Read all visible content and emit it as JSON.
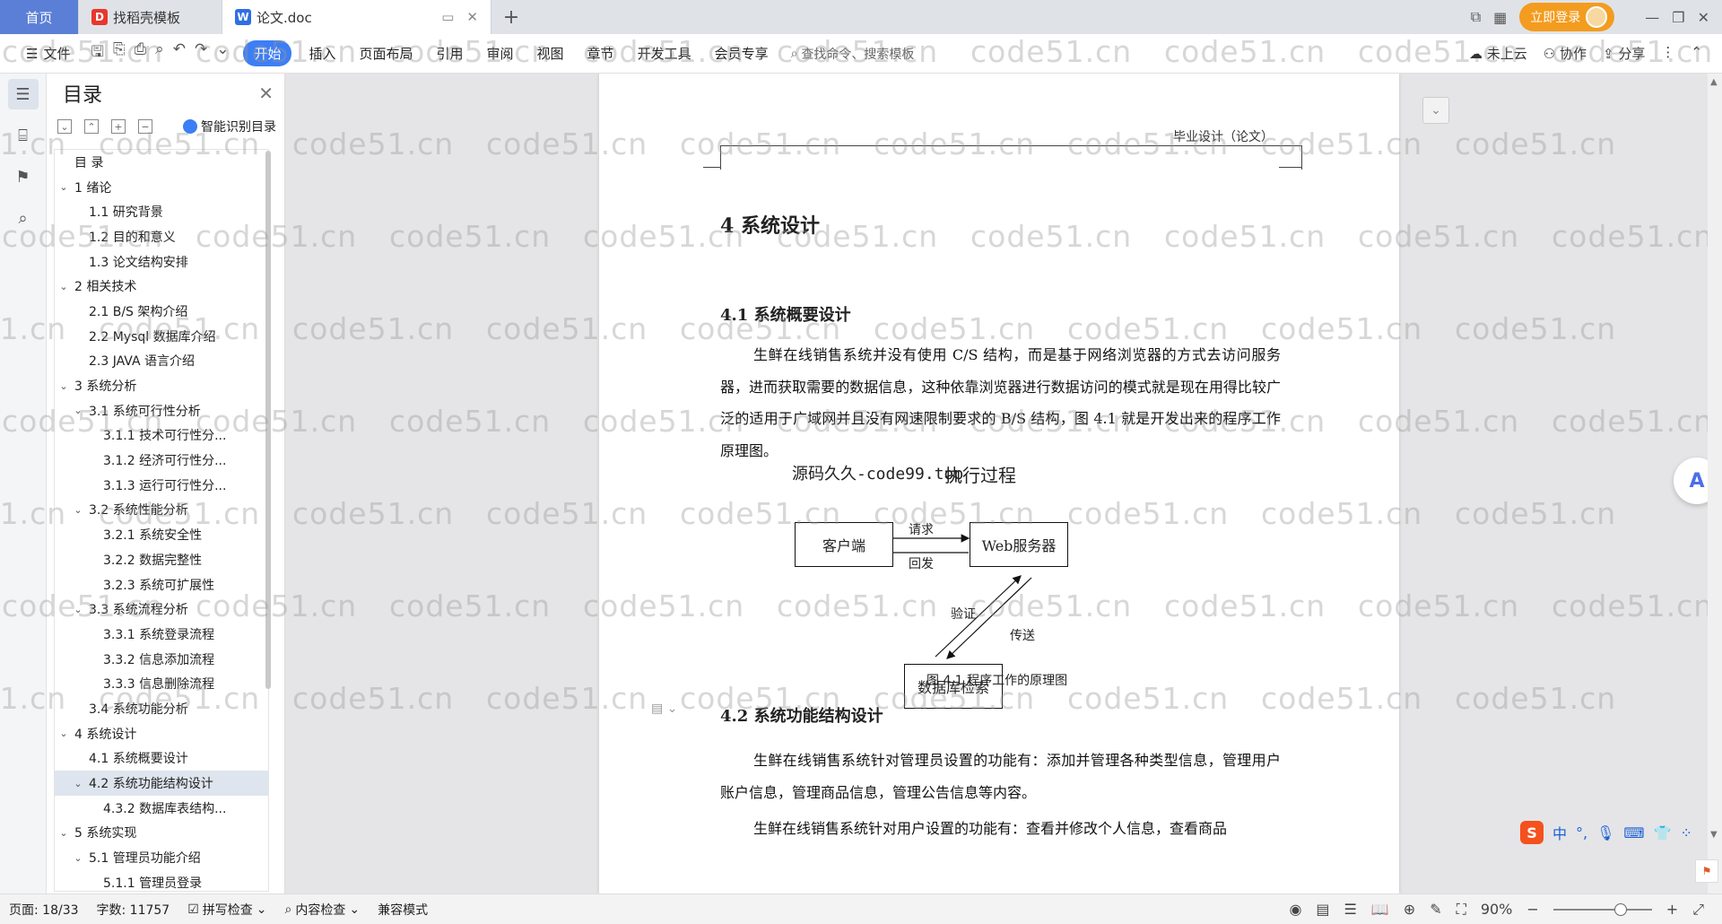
{
  "titlebar": {
    "tabs": [
      {
        "label": "首页"
      },
      {
        "label": "找稻壳模板"
      },
      {
        "label": "论文.doc"
      }
    ],
    "login_label": "立即登录"
  },
  "menubar": {
    "file": "文件",
    "start": "开始",
    "items": [
      "插入",
      "页面布局",
      "引用",
      "审阅",
      "视图",
      "章节",
      "开发工具",
      "会员专享"
    ],
    "search_placeholder": "查找命令、搜索模板",
    "cloud": "未上云",
    "collab": "协作",
    "share": "分享"
  },
  "toc": {
    "title": "目录",
    "ai_label": "智能识别目录",
    "items": [
      {
        "text": "目  录",
        "level": 1,
        "arrow": ""
      },
      {
        "text": "1  绪论",
        "level": 1,
        "arrow": "v"
      },
      {
        "text": "1.1  研究背景",
        "level": 2,
        "arrow": ""
      },
      {
        "text": "1.2 目的和意义",
        "level": 2,
        "arrow": ""
      },
      {
        "text": "1.3  论文结构安排",
        "level": 2,
        "arrow": ""
      },
      {
        "text": "2  相关技术",
        "level": 1,
        "arrow": "v"
      },
      {
        "text": "2.1 B/S 架构介绍",
        "level": 2,
        "arrow": ""
      },
      {
        "text": "2.2 Mysql 数据库介绍",
        "level": 2,
        "arrow": ""
      },
      {
        "text": "2.3 JAVA 语言介绍",
        "level": 2,
        "arrow": ""
      },
      {
        "text": "3  系统分析",
        "level": 1,
        "arrow": "v"
      },
      {
        "text": "3.1 系统可行性分析",
        "level": 2,
        "arrow": "v"
      },
      {
        "text": "3.1.1  技术可行性分...",
        "level": 3,
        "arrow": ""
      },
      {
        "text": "3.1.2  经济可行性分...",
        "level": 3,
        "arrow": ""
      },
      {
        "text": "3.1.3  运行可行性分...",
        "level": 3,
        "arrow": ""
      },
      {
        "text": "3.2 系统性能分析",
        "level": 2,
        "arrow": "v"
      },
      {
        "text": "3.2.1  系统安全性",
        "level": 3,
        "arrow": ""
      },
      {
        "text": "3.2.2  数据完整性",
        "level": 3,
        "arrow": ""
      },
      {
        "text": "3.2.3 系统可扩展性",
        "level": 3,
        "arrow": ""
      },
      {
        "text": "3.3 系统流程分析",
        "level": 2,
        "arrow": "v"
      },
      {
        "text": "3.3.1 系统登录流程",
        "level": 3,
        "arrow": ""
      },
      {
        "text": "3.3.2 信息添加流程",
        "level": 3,
        "arrow": ""
      },
      {
        "text": "3.3.3 信息删除流程",
        "level": 3,
        "arrow": ""
      },
      {
        "text": "3.4 系统功能分析",
        "level": 2,
        "arrow": ""
      },
      {
        "text": "4  系统设计",
        "level": 1,
        "arrow": "v"
      },
      {
        "text": "4.1 系统概要设计",
        "level": 2,
        "arrow": ""
      },
      {
        "text": "4.2 系统功能结构设计",
        "level": 2,
        "arrow": "v",
        "selected": true
      },
      {
        "text": "4.3.2  数据库表结构...",
        "level": 3,
        "arrow": ""
      },
      {
        "text": "5  系统实现",
        "level": 1,
        "arrow": "v"
      },
      {
        "text": "5.1 管理员功能介绍",
        "level": 2,
        "arrow": "v"
      },
      {
        "text": "5.1.1 管理员登录",
        "level": 3,
        "arrow": ""
      }
    ]
  },
  "doc": {
    "header": "毕业设计（论文）",
    "h1": "4  系统设计",
    "h2_1": "4.1 系统概要设计",
    "para1": "生鲜在线销售系统并没有使用 C/S 结构，而是基于网络浏览器的方式去访问服务器，进而获取需要的数据信息，这种依靠浏览器进行数据访问的模式就是现在用得比较广泛的适用于广域网并且没有网速限制要求的 B/S 结构，图 4.1 就是开发出来的程序工作原理图。",
    "watermark_src": "源码久久-code99.top",
    "diagram": {
      "title": "执行过程",
      "client": "客户端",
      "web": "Web服务器",
      "db": "数据库检索",
      "request": "请求",
      "reply": "回发",
      "verify": "验证",
      "send": "传送",
      "caption": "图 4.1  程序工作的原理图"
    },
    "h2_2": "4.2 系统功能结构设计",
    "para2": "生鲜在线销售系统针对管理员设置的功能有：添加并管理各种类型信息，管理用户账户信息，管理商品信息，管理公告信息等内容。",
    "para3": "生鲜在线销售系统针对用户设置的功能有：查看并修改个人信息，查看商品"
  },
  "watermark_text": "code51.cn",
  "statusbar": {
    "page": "页面: 18/33",
    "words": "字数: 11757",
    "spell": "拼写检查",
    "content_check": "内容检查",
    "compat": "兼容模式",
    "zoom": "90%"
  },
  "ime": {
    "lang": "中"
  }
}
